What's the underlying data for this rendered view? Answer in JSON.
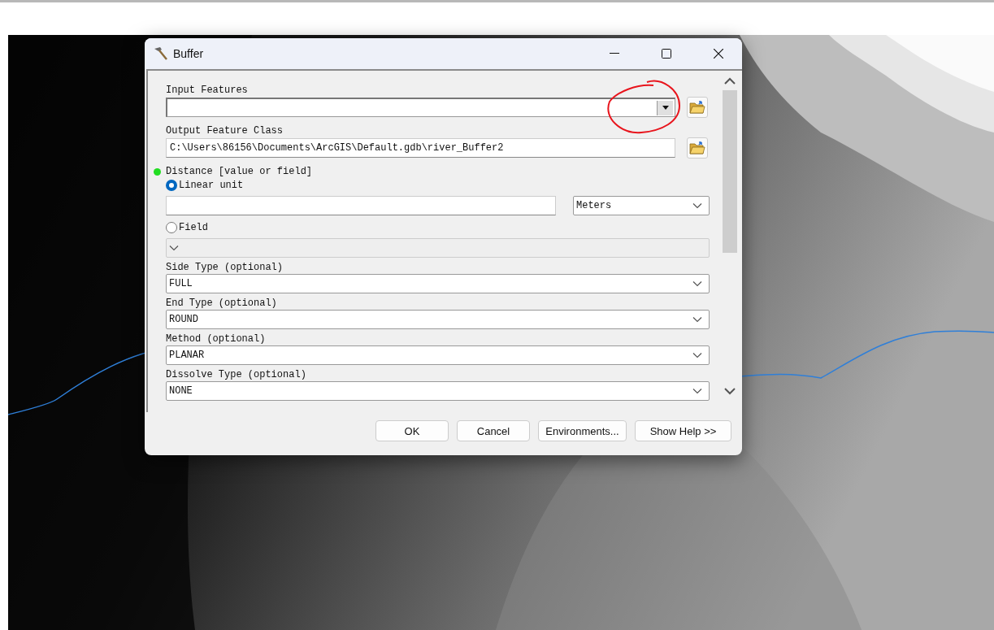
{
  "window": {
    "title": "Buffer"
  },
  "params": [
    {
      "kind": "combo",
      "label": "Input Features",
      "required": false,
      "browse": true
    },
    {
      "kind": "text",
      "label": "Output Feature Class",
      "required": false,
      "browse": true,
      "value": "C:\\Users\\86156\\Documents\\ArcGIS\\Default.gdb\\river_Buffer2"
    },
    {
      "kind": "distance",
      "label": "Distance [value or field]",
      "required": true,
      "unit": "Meters",
      "options": [
        {
          "kind": "unit",
          "label": "Linear unit",
          "selected": true
        },
        {
          "kind": "field",
          "label": "Field",
          "selected": false
        }
      ]
    },
    {
      "kind": "select",
      "label": "Side Type (optional)",
      "required": false,
      "value": "FULL"
    },
    {
      "kind": "select",
      "label": "End Type (optional)",
      "required": false,
      "value": "ROUND"
    },
    {
      "kind": "select",
      "label": "Method (optional)",
      "required": false,
      "value": "PLANAR"
    },
    {
      "kind": "select",
      "label": "Dissolve Type (optional)",
      "required": false,
      "value": "NONE"
    }
  ],
  "buttons": [
    "OK",
    "Cancel",
    "Environments...",
    "Show Help >>"
  ]
}
